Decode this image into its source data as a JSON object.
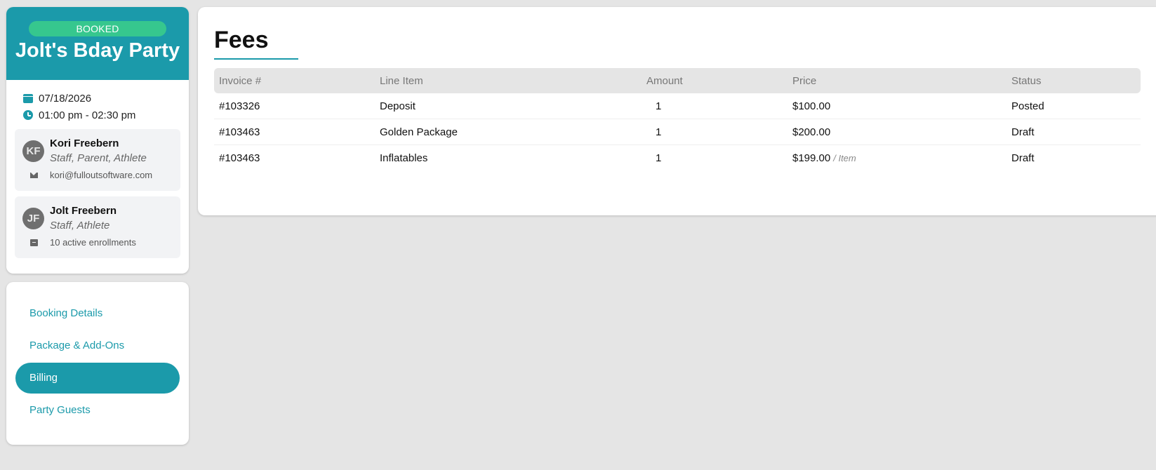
{
  "event": {
    "status_badge": "BOOKED",
    "title": "Jolt's Bday Party",
    "date": "07/18/2026",
    "time": "01:00 pm - 02:30 pm"
  },
  "people": [
    {
      "initials": "KF",
      "name": "Kori Freebern",
      "roles": "Staff, Parent, Athlete",
      "detail_icon": "mail-icon",
      "detail": "kori@fulloutsoftware.com"
    },
    {
      "initials": "JF",
      "name": "Jolt Freebern",
      "roles": "Staff, Athlete",
      "detail_icon": "enrollment-icon",
      "detail": "10 active enrollments"
    }
  ],
  "nav": {
    "items": [
      {
        "label": "Booking Details",
        "active": false
      },
      {
        "label": "Package & Add-Ons",
        "active": false
      },
      {
        "label": "Billing",
        "active": true
      },
      {
        "label": "Party Guests",
        "active": false
      }
    ]
  },
  "fees": {
    "title": "Fees",
    "columns": [
      "Invoice #",
      "Line Item",
      "Amount",
      "Price",
      "Status"
    ],
    "rows": [
      {
        "invoice": "#103326",
        "line_item": "Deposit",
        "amount": "1",
        "price": "$100.00",
        "unit": "",
        "status": "Posted"
      },
      {
        "invoice": "#103463",
        "line_item": "Golden Package",
        "amount": "1",
        "price": "$200.00",
        "unit": "",
        "status": "Draft"
      },
      {
        "invoice": "#103463",
        "line_item": "Inflatables",
        "amount": "1",
        "price": "$199.00",
        "unit": "/ Item",
        "status": "Draft"
      }
    ]
  },
  "colors": {
    "brand": "#1b9aaa",
    "booked_badge": "#36c78e",
    "page_background": "#e5e5e5"
  }
}
